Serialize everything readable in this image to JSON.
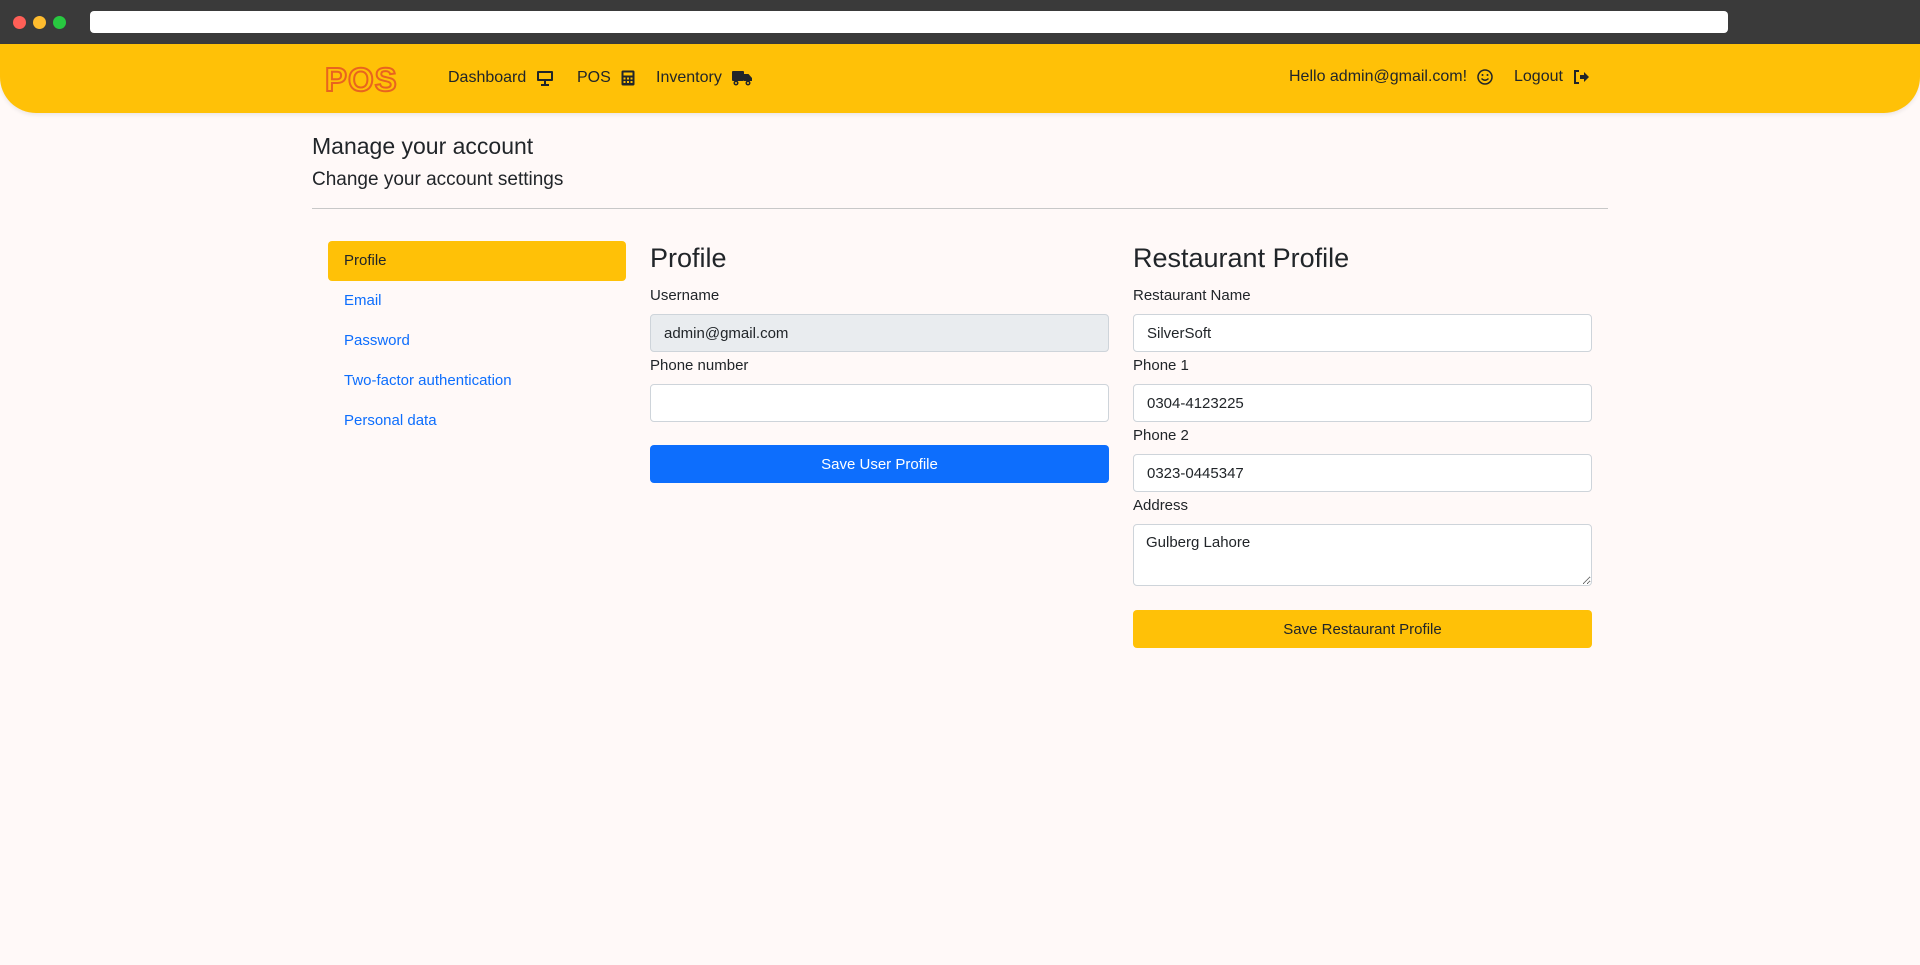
{
  "nav": {
    "logo_text": "POS",
    "items": [
      {
        "label": "Dashboard",
        "icon": "monitor-icon"
      },
      {
        "label": "POS",
        "icon": "calculator-icon"
      },
      {
        "label": "Inventory",
        "icon": "truck-icon"
      }
    ],
    "hello": "Hello admin@gmail.com!",
    "logout": "Logout"
  },
  "page": {
    "title": "Manage your account",
    "subtitle": "Change your account settings"
  },
  "sidebar": {
    "items": [
      {
        "label": "Profile",
        "active": true
      },
      {
        "label": "Email"
      },
      {
        "label": "Password"
      },
      {
        "label": "Two-factor authentication"
      },
      {
        "label": "Personal data"
      }
    ]
  },
  "profile": {
    "title": "Profile",
    "username_label": "Username",
    "username_value": "admin@gmail.com",
    "phone_label": "Phone number",
    "phone_value": "",
    "save_label": "Save User Profile"
  },
  "restaurant": {
    "title": "Restaurant Profile",
    "name_label": "Restaurant Name",
    "name_value": "SilverSoft",
    "phone1_label": "Phone 1",
    "phone1_value": "0304-4123225",
    "phone2_label": "Phone 2",
    "phone2_value": "0323-0445347",
    "address_label": "Address",
    "address_value": "Gulberg Lahore",
    "save_label": "Save Restaurant Profile"
  },
  "colors": {
    "accent": "#ffc107",
    "primary": "#0d6efd",
    "logo": "#e8641f"
  }
}
